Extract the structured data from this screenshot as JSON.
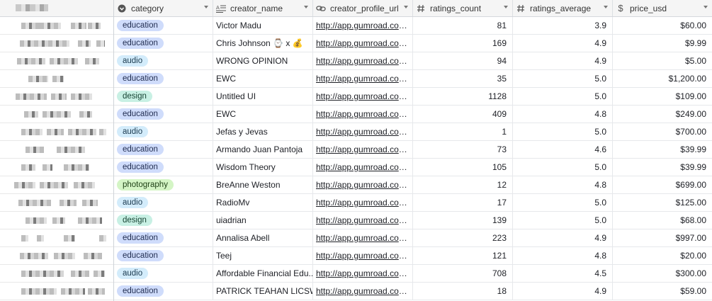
{
  "columns": [
    {
      "label": "category",
      "icon": "single-select-icon"
    },
    {
      "label": "creator_name",
      "icon": "long-text-icon"
    },
    {
      "label": "creator_profile_url",
      "icon": "link-icon"
    },
    {
      "label": "ratings_count",
      "icon": "number-icon"
    },
    {
      "label": "ratings_average",
      "icon": "number-icon"
    },
    {
      "label": "price_usd",
      "icon": "currency-icon"
    }
  ],
  "rows": [
    {
      "category": "education",
      "creator_name": "Victor Madu",
      "url": "http://app.gumroad.com/...",
      "ratings_count": "81",
      "ratings_average": "3.9",
      "price": "$60.00"
    },
    {
      "category": "education",
      "creator_name": "Chris Johnson ⌚ x 💰",
      "url": "http://app.gumroad.com/...",
      "ratings_count": "169",
      "ratings_average": "4.9",
      "price": "$9.99"
    },
    {
      "category": "audio",
      "creator_name": "WRONG OPINION",
      "url": "http://app.gumroad.com/...",
      "ratings_count": "94",
      "ratings_average": "4.9",
      "price": "$5.00"
    },
    {
      "category": "education",
      "creator_name": "EWC",
      "url": "http://app.gumroad.com/...",
      "ratings_count": "35",
      "ratings_average": "5.0",
      "price": "$1,200.00"
    },
    {
      "category": "design",
      "creator_name": "Untitled UI",
      "url": "http://app.gumroad.com/...",
      "ratings_count": "1128",
      "ratings_average": "5.0",
      "price": "$109.00"
    },
    {
      "category": "education",
      "creator_name": "EWC",
      "url": "http://app.gumroad.com/...",
      "ratings_count": "409",
      "ratings_average": "4.8",
      "price": "$249.00"
    },
    {
      "category": "audio",
      "creator_name": "Jefas y Jevas",
      "url": "http://app.gumroad.com/...",
      "ratings_count": "1",
      "ratings_average": "5.0",
      "price": "$700.00"
    },
    {
      "category": "education",
      "creator_name": "Armando Juan Pantoja",
      "url": "http://app.gumroad.com/...",
      "ratings_count": "73",
      "ratings_average": "4.6",
      "price": "$39.99"
    },
    {
      "category": "education",
      "creator_name": "Wisdom Theory",
      "url": "http://app.gumroad.com/...",
      "ratings_count": "105",
      "ratings_average": "5.0",
      "price": "$39.99"
    },
    {
      "category": "photography",
      "creator_name": "BreAnne Weston",
      "url": "http://app.gumroad.com/...",
      "ratings_count": "12",
      "ratings_average": "4.8",
      "price": "$699.00"
    },
    {
      "category": "audio",
      "creator_name": "RadioMv",
      "url": "http://app.gumroad.com/...",
      "ratings_count": "17",
      "ratings_average": "5.0",
      "price": "$125.00"
    },
    {
      "category": "design",
      "creator_name": "uiadrian",
      "url": "http://app.gumroad.com/...",
      "ratings_count": "139",
      "ratings_average": "5.0",
      "price": "$68.00"
    },
    {
      "category": "education",
      "creator_name": "Annalisa Abell",
      "url": "http://app.gumroad.com/...",
      "ratings_count": "223",
      "ratings_average": "4.9",
      "price": "$997.00"
    },
    {
      "category": "education",
      "creator_name": "Teej",
      "url": "http://app.gumroad.com/...",
      "ratings_count": "121",
      "ratings_average": "4.8",
      "price": "$20.00"
    },
    {
      "category": "audio",
      "creator_name": "Affordable Financial Edu...",
      "url": "http://app.gumroad.com/...",
      "ratings_count": "708",
      "ratings_average": "4.5",
      "price": "$300.00"
    },
    {
      "category": "education",
      "creator_name": "PATRICK TEAHAN LICSW",
      "url": "http://app.gumroad.com/...",
      "ratings_count": "18",
      "ratings_average": "4.9",
      "price": "$59.00"
    }
  ],
  "colors": {
    "education": "#cfdcfb",
    "audio": "#d3ecfb",
    "design": "#c8f0e4",
    "photography": "#d4f5c5"
  }
}
